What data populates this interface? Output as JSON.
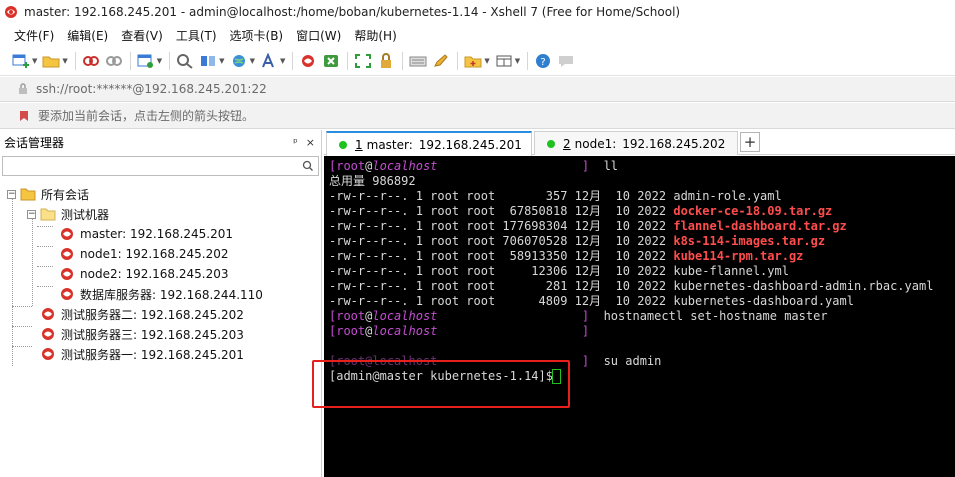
{
  "window": {
    "title": "master:  192.168.245.201 - admin@localhost:/home/boban/kubernetes-1.14 - Xshell 7 (Free for Home/School)"
  },
  "menu": {
    "items": [
      {
        "label": "文件(F)"
      },
      {
        "label": "编辑(E)"
      },
      {
        "label": "查看(V)"
      },
      {
        "label": "工具(T)"
      },
      {
        "label": "选项卡(B)"
      },
      {
        "label": "窗口(W)"
      },
      {
        "label": "帮助(H)"
      }
    ]
  },
  "address": {
    "text": "ssh://root:******@192.168.245.201:22"
  },
  "hint": {
    "text": "要添加当前会话，点击左侧的箭头按钮。"
  },
  "session_manager": {
    "title": "会话管理器",
    "pin": "ᵖ",
    "close": "×",
    "tree": {
      "root": "所有会话",
      "group": "测试机器",
      "group_items": [
        "master:  192.168.245.201",
        "node1:  192.168.245.202",
        "node2:  192.168.245.203",
        "数据库服务器:  192.168.244.110"
      ],
      "servers": [
        "测试服务器二:  192.168.245.202",
        "测试服务器三:  192.168.245.203",
        "测试服务器一:  192.168.245.201"
      ]
    }
  },
  "tabs": [
    {
      "num": "1",
      "name": "master:",
      "host": "192.168.245.201",
      "active": true
    },
    {
      "num": "2",
      "name": "node1:",
      "host": "192.168.245.202",
      "active": false
    }
  ],
  "terminal": {
    "prompt_user": "root",
    "prompt_at": "@",
    "prompt_host": "localhost",
    "cmd_ll": "ll",
    "total": "总用量 986892",
    "files": [
      {
        "meta": "-rw-r--r--. 1 root root       357 12月  10 2022 ",
        "name": "admin-role.yaml",
        "red": false
      },
      {
        "meta": "-rw-r--r--. 1 root root  67850818 12月  10 2022 ",
        "name": "docker-ce-18.09.tar.gz",
        "red": true
      },
      {
        "meta": "-rw-r--r--. 1 root root 177698304 12月  10 2022 ",
        "name": "flannel-dashboard.tar.gz",
        "red": true
      },
      {
        "meta": "-rw-r--r--. 1 root root 706070528 12月  10 2022 ",
        "name": "k8s-114-images.tar.gz",
        "red": true
      },
      {
        "meta": "-rw-r--r--. 1 root root  58913350 12月  10 2022 ",
        "name": "kube114-rpm.tar.gz",
        "red": true
      },
      {
        "meta": "-rw-r--r--. 1 root root     12306 12月  10 2022 ",
        "name": "kube-flannel.yml",
        "red": false
      },
      {
        "meta": "-rw-r--r--. 1 root root       281 12月  10 2022 ",
        "name": "kubernetes-dashboard-admin.rbac.yaml",
        "red": false
      },
      {
        "meta": "-rw-r--r--. 1 root root      4809 12月  10 2022 ",
        "name": "kubernetes-dashboard.yaml",
        "red": false
      }
    ],
    "cmd_hostname": "hostnamectl set-hostname master",
    "cmd_su": "su admin",
    "final_prompt": "[admin@master kubernetes-1.14]$ "
  },
  "colors": {
    "accent": "#2b8de0",
    "terminal_bg": "#000000",
    "prompt": "#c34dd1",
    "highlight": "#e8201c",
    "connected_dot": "#1ec21e"
  }
}
